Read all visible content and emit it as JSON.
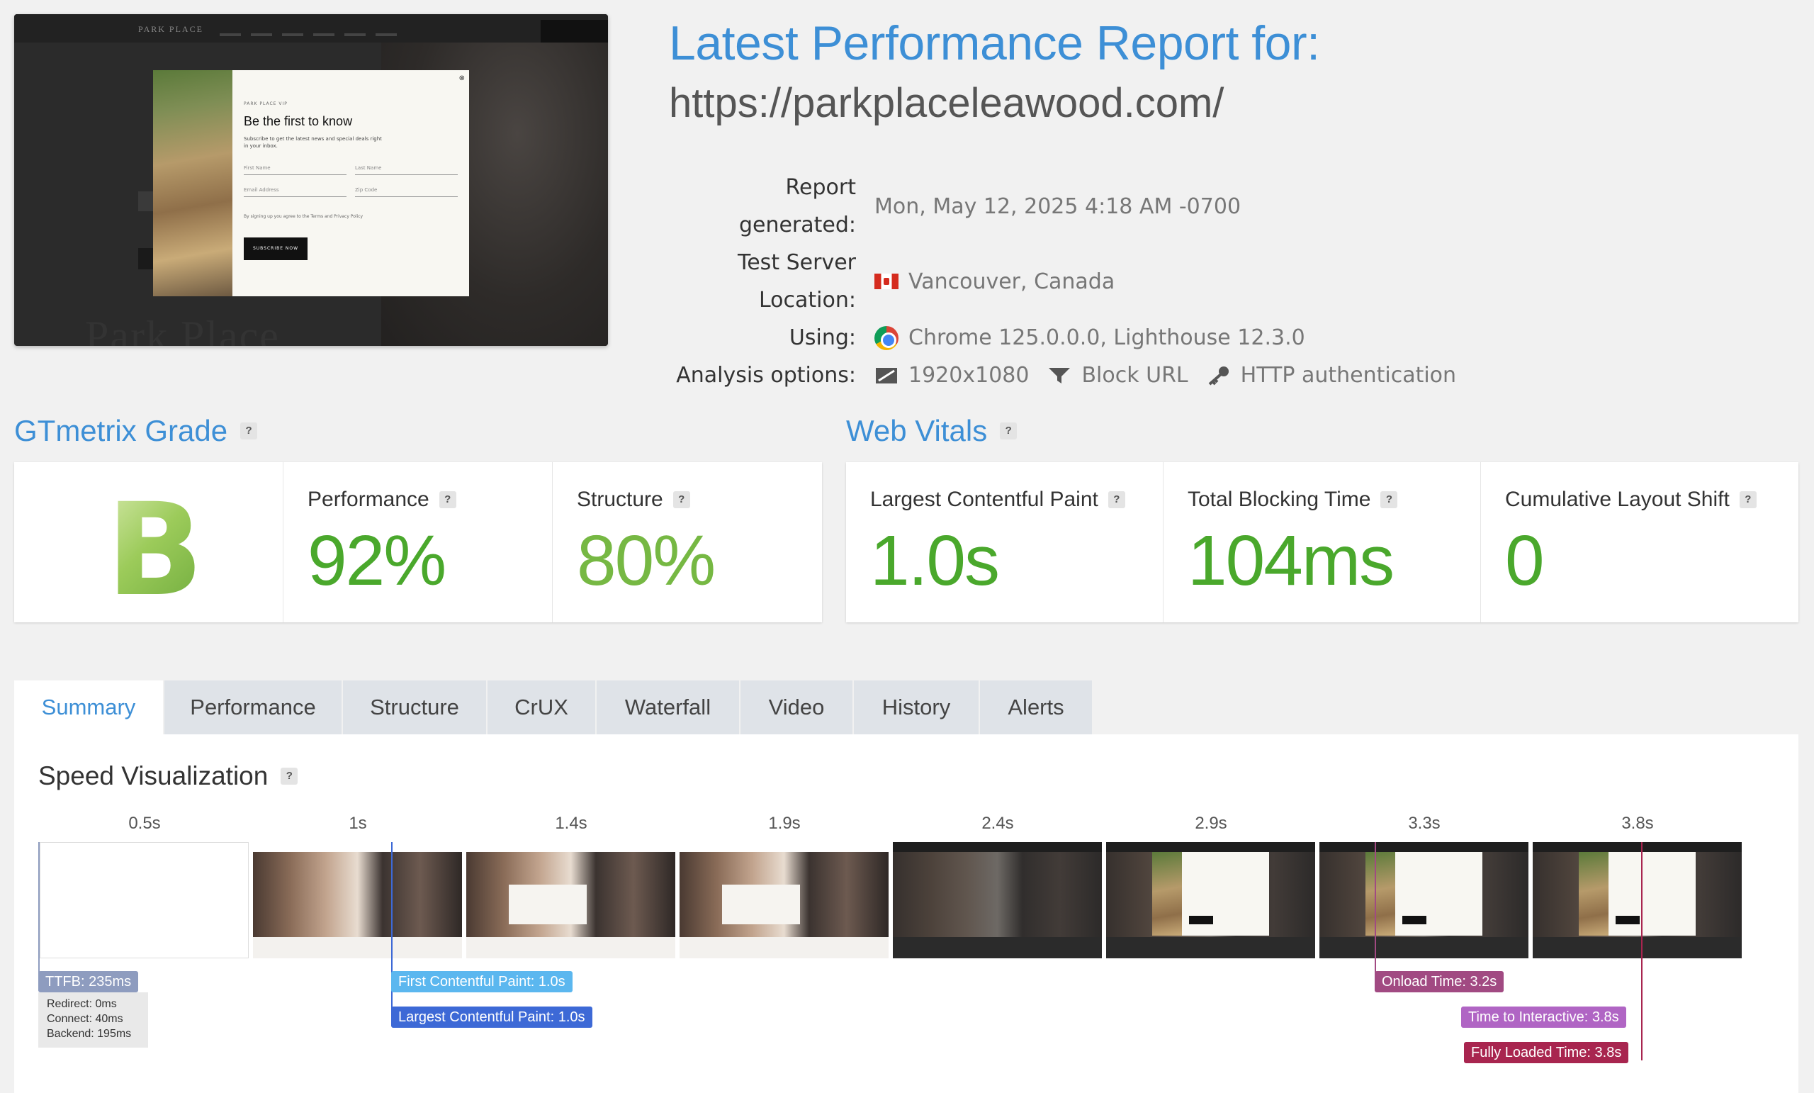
{
  "screenshot": {
    "logo": "PARK PLACE",
    "popup": {
      "tag": "PARK PLACE VIP",
      "title": "Be the first to know",
      "description": "Subscribe to get the latest news and special deals right in your inbox.",
      "first_name": "First Name",
      "last_name": "Last Name",
      "email": "Email Address",
      "zip": "Zip Code",
      "consent": "By signing up you agree to the Terms and Privacy Policy",
      "button": "SUBSCRIBE NOW",
      "close": "⊗"
    },
    "watermark": "Park Place"
  },
  "header": {
    "title": "Latest Performance Report for:",
    "url": "https://parkplaceleawood.com/"
  },
  "meta": {
    "report_generated_label": "Report generated:",
    "report_generated_value": "Mon, May 12, 2025 4:18 AM -0700",
    "location_label": "Test Server Location:",
    "location_value": "Vancouver, Canada",
    "using_label": "Using:",
    "using_value": "Chrome 125.0.0.0, Lighthouse 12.3.0",
    "options_label": "Analysis options:",
    "options": [
      "1920x1080",
      "Block URL",
      "HTTP authentication"
    ]
  },
  "grade": {
    "heading": "GTmetrix Grade",
    "letter": "B",
    "performance_label": "Performance",
    "performance_value": "92%",
    "structure_label": "Structure",
    "structure_value": "80%"
  },
  "vitals": {
    "heading": "Web Vitals",
    "lcp_label": "Largest Contentful Paint",
    "lcp_value": "1.0s",
    "tbt_label": "Total Blocking Time",
    "tbt_value": "104ms",
    "cls_label": "Cumulative Layout Shift",
    "cls_value": "0"
  },
  "tabs": [
    "Summary",
    "Performance",
    "Structure",
    "CrUX",
    "Waterfall",
    "Video",
    "History",
    "Alerts"
  ],
  "help_mark": "?",
  "speed": {
    "heading": "Speed Visualization",
    "times": [
      "0.5s",
      "1s",
      "1.4s",
      "1.9s",
      "2.4s",
      "2.9s",
      "3.3s",
      "3.8s"
    ],
    "markers": {
      "ttfb": "TTFB: 235ms",
      "fcp": "First Contentful Paint: 1.0s",
      "lcp": "Largest Contentful Paint: 1.0s",
      "onload": "Onload Time: 3.2s",
      "tti": "Time to Interactive: 3.8s",
      "fully_loaded": "Fully Loaded Time: 3.8s"
    },
    "ttfb_breakdown": [
      "Redirect: 0ms",
      "Connect: 40ms",
      "Backend: 195ms"
    ]
  },
  "colors": {
    "accent": "#3d8fd6",
    "grade_green": "#4aa82c",
    "ttfb": "#8e9cbf",
    "fcp": "#5bb7ef",
    "lcp": "#3d69d6",
    "onload": "#a14a82",
    "tti": "#b065c4",
    "fully_loaded": "#a8254f"
  }
}
